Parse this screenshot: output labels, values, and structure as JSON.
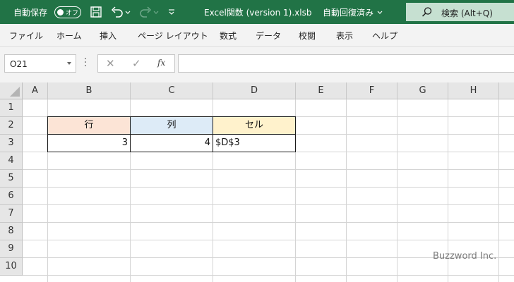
{
  "titlebar": {
    "autosave_label": "自動保存",
    "autosave_state": "オフ",
    "title": "Excel関数 (version 1).xlsb",
    "save_status": "自動回復済み",
    "search": "検索 (Alt+Q)"
  },
  "ribbon": {
    "tabs": [
      "ファイル",
      "ホーム",
      "挿入",
      "ページ レイアウト",
      "数式",
      "データ",
      "校閲",
      "表示",
      "ヘルプ"
    ]
  },
  "formula_bar": {
    "name_box": "O21",
    "cancel_glyph": "✕",
    "enter_glyph": "✓",
    "fx_label": "fx",
    "content": ""
  },
  "grid": {
    "columns": [
      "A",
      "B",
      "C",
      "D",
      "E",
      "F",
      "G",
      "H"
    ],
    "rows": [
      "1",
      "2",
      "3",
      "4",
      "5",
      "6",
      "7",
      "8",
      "9",
      "10"
    ],
    "header_row": {
      "b": "行",
      "c": "列",
      "d": "セル"
    },
    "value_row": {
      "b": "3",
      "c": "4",
      "d": "$D$3"
    },
    "fill_colors": {
      "b": "#fce4d6",
      "c": "#ddebf7",
      "d": "#fff2cc"
    }
  },
  "watermark": "Buzzword Inc.",
  "colors": {
    "accent": "#217346",
    "search_bg": "#c6e0d1"
  }
}
